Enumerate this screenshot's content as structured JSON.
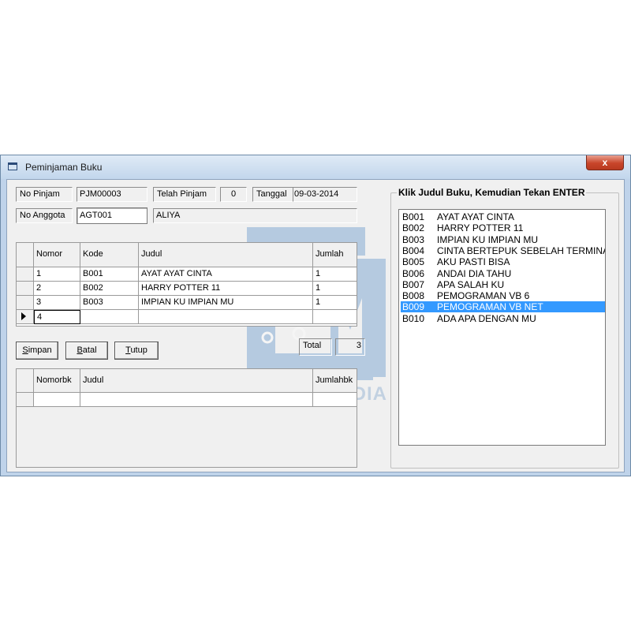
{
  "window": {
    "title": "Peminjaman Buku",
    "close_label": "x"
  },
  "header": {
    "no_pinjam_label": "No Pinjam",
    "no_pinjam_value": "PJM00003",
    "telah_pinjam_label": "Telah Pinjam",
    "telah_pinjam_value": "0",
    "tanggal_label": "Tanggal",
    "tanggal_value": "09-03-2014",
    "no_anggota_label": "No Anggota",
    "no_anggota_value": "AGT001",
    "nama_anggota": "ALIYA"
  },
  "loan_grid": {
    "columns": [
      "Nomor",
      "Kode",
      "Judul",
      "Jumlah"
    ],
    "rows": [
      [
        "1",
        "B001",
        "AYAT AYAT CINTA",
        "1"
      ],
      [
        "2",
        "B002",
        "HARRY POTTER 11",
        "1"
      ],
      [
        "3",
        "B003",
        "IMPIAN KU IMPIAN MU",
        "1"
      ],
      [
        "4",
        "",
        "",
        ""
      ]
    ]
  },
  "buttons": {
    "simpan_key": "S",
    "simpan_rest": "impan",
    "batal_key": "B",
    "batal_rest": "atal",
    "tutup_key": "T",
    "tutup_rest": "utup"
  },
  "total": {
    "label": "Total",
    "value": "3"
  },
  "detail_grid": {
    "columns": [
      "Nomorbk",
      "Judul",
      "Jumlahbk"
    ]
  },
  "book_list": {
    "title": "Klik Judul Buku, Kemudian Tekan ENTER",
    "selected_index": 8,
    "items": [
      {
        "code": "B001",
        "title": "AYAT AYAT CINTA"
      },
      {
        "code": "B002",
        "title": "HARRY POTTER 11"
      },
      {
        "code": "B003",
        "title": "IMPIAN KU IMPIAN MU"
      },
      {
        "code": "B004",
        "title": "CINTA BERTEPUK SEBELAH TERMINAL"
      },
      {
        "code": "B005",
        "title": "AKU PASTI BISA"
      },
      {
        "code": "B006",
        "title": "ANDAI DIA TAHU"
      },
      {
        "code": "B007",
        "title": "APA SALAH KU"
      },
      {
        "code": "B008",
        "title": "PEMOGRAMAN VB 6"
      },
      {
        "code": "B009",
        "title": "PEMOGRAMAN VB NET"
      },
      {
        "code": "B010",
        "title": "ADA APA DENGAN MU"
      }
    ]
  },
  "watermark": {
    "text": "EDISON MEDIA"
  },
  "colors": {
    "selection": "#3399ff",
    "frame": "#bfd3ea",
    "close": "#c8452a"
  }
}
